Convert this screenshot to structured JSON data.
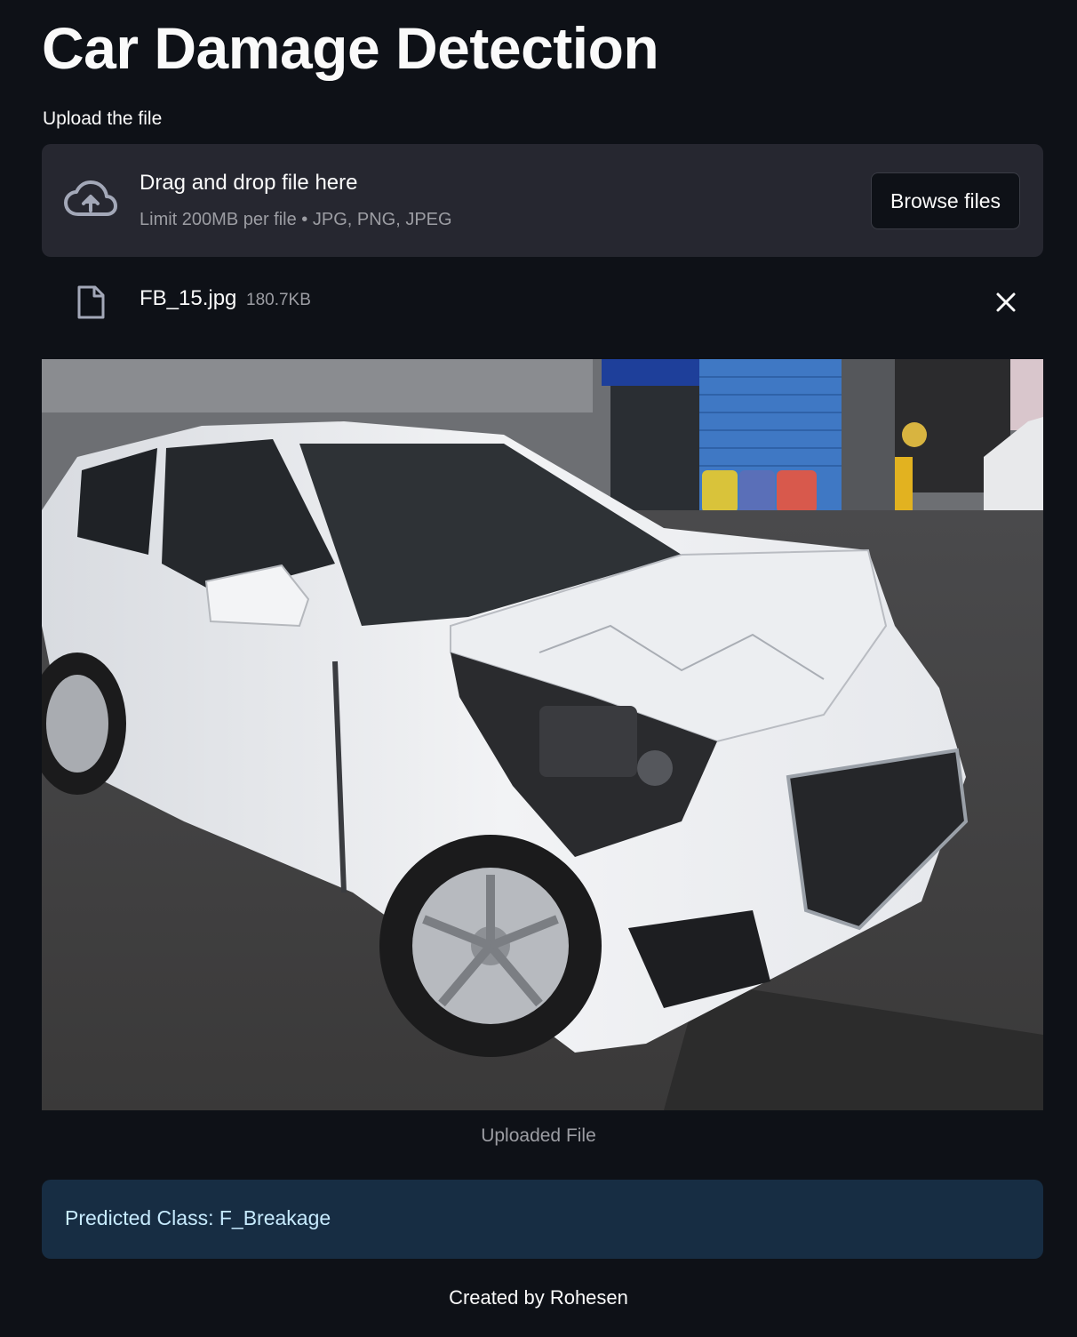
{
  "header": {
    "title": "Car Damage Detection"
  },
  "uploader": {
    "label": "Upload the file",
    "drop_text": "Drag and drop file here",
    "limit_text": "Limit 200MB per file • JPG, PNG, JPEG",
    "browse_label": "Browse files",
    "cloud_icon": "cloud-upload-icon"
  },
  "uploaded_file": {
    "name": "FB_15.jpg",
    "size": "180.7KB",
    "file_icon": "file-icon",
    "remove_icon": "close-icon"
  },
  "image": {
    "caption": "Uploaded File"
  },
  "result": {
    "text": "Predicted Class: F_Breakage"
  },
  "footer": {
    "text": "Created by Rohesen"
  },
  "colors": {
    "background": "#0e1117",
    "dropzone": "#262730",
    "alert_bg": "#172d43",
    "alert_text": "#c7ebff",
    "muted_text": "#9c9da3"
  }
}
